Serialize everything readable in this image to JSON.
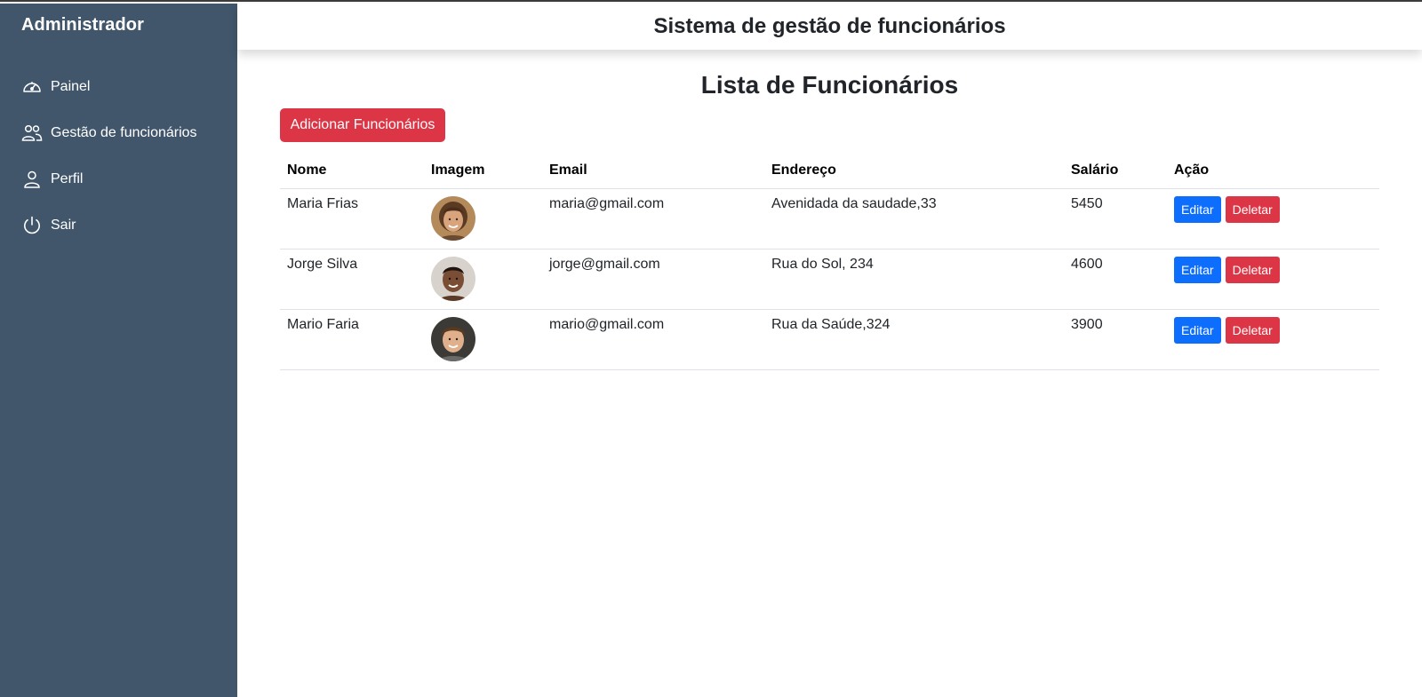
{
  "sidebar": {
    "brand": "Administrador",
    "items": [
      {
        "label": "Painel",
        "icon": "speedometer-icon"
      },
      {
        "label": "Gestão de funcionários",
        "icon": "people-icon"
      },
      {
        "label": "Perfil",
        "icon": "person-icon"
      },
      {
        "label": "Sair",
        "icon": "power-icon"
      }
    ],
    "bg_color": "#41566b"
  },
  "header": {
    "title": "Sistema de gestão de funcionários"
  },
  "main": {
    "title": "Lista de Funcionários",
    "add_button": "Adicionar Funcionários",
    "table": {
      "columns": [
        "Nome",
        "Imagem",
        "Email",
        "Endereço",
        "Salário",
        "Ação"
      ],
      "rows": [
        {
          "name": "Maria Frias",
          "email": "maria@gmail.com",
          "address": "Avenidada da saudade,33",
          "salary": "5450",
          "edit": "Editar",
          "delete": "Deletar"
        },
        {
          "name": "Jorge Silva",
          "email": "jorge@gmail.com",
          "address": "Rua do Sol, 234",
          "salary": "4600",
          "edit": "Editar",
          "delete": "Deletar"
        },
        {
          "name": "Mario Faria",
          "email": "mario@gmail.com",
          "address": "Rua da Saúde,324",
          "salary": "3900",
          "edit": "Editar",
          "delete": "Deletar"
        }
      ]
    }
  },
  "colors": {
    "danger": "#dc3545",
    "primary": "#0d6efd"
  }
}
